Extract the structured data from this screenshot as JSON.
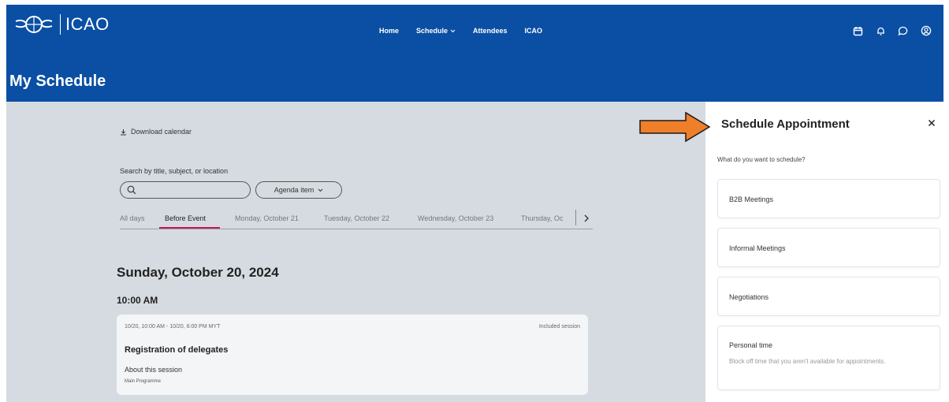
{
  "brand": {
    "name": "ICAO"
  },
  "nav": [
    {
      "label": "Home"
    },
    {
      "label": "Schedule"
    },
    {
      "label": "Attendees"
    },
    {
      "label": "ICAO"
    }
  ],
  "page_title": "My Schedule",
  "schedule": {
    "download_label": "Download calendar",
    "search_label": "Search by title, subject, or location",
    "search_value": "",
    "agenda_filter": "Agenda item",
    "tabs": [
      {
        "label": "All days"
      },
      {
        "label": "Before Event",
        "active": true
      },
      {
        "label": "Monday, October 21"
      },
      {
        "label": "Tuesday, October 22"
      },
      {
        "label": "Wednesday, October 23"
      },
      {
        "label": "Thursday, Oc"
      }
    ],
    "date_heading": "Sunday, October 20, 2024",
    "time_heading": "10:00 AM",
    "session": {
      "time_range": "10/20, 10:00 AM - 10/20, 6:00 PM MYT",
      "badge": "Included session",
      "title": "Registration of delegates",
      "about": "About this session",
      "programme": "Main Programme"
    }
  },
  "panel": {
    "title": "Schedule Appointment",
    "question": "What do you want to schedule?",
    "options": [
      {
        "label": "B2B Meetings"
      },
      {
        "label": "Informal Meetings"
      },
      {
        "label": "Negotiations"
      },
      {
        "label": "Personal time",
        "description": "Block off time that you aren't available for appointments."
      }
    ]
  },
  "colors": {
    "header": "#0a4fa3",
    "backdrop": "#d6dbe1",
    "active_tab_underline": "#c2185b",
    "annotation_arrow": "#f07f2a"
  },
  "icons": [
    "download-icon",
    "search-icon",
    "chevron-down-icon",
    "chevron-right-icon",
    "calendar-icon",
    "bell-icon",
    "chat-icon",
    "account-icon",
    "close-icon"
  ]
}
